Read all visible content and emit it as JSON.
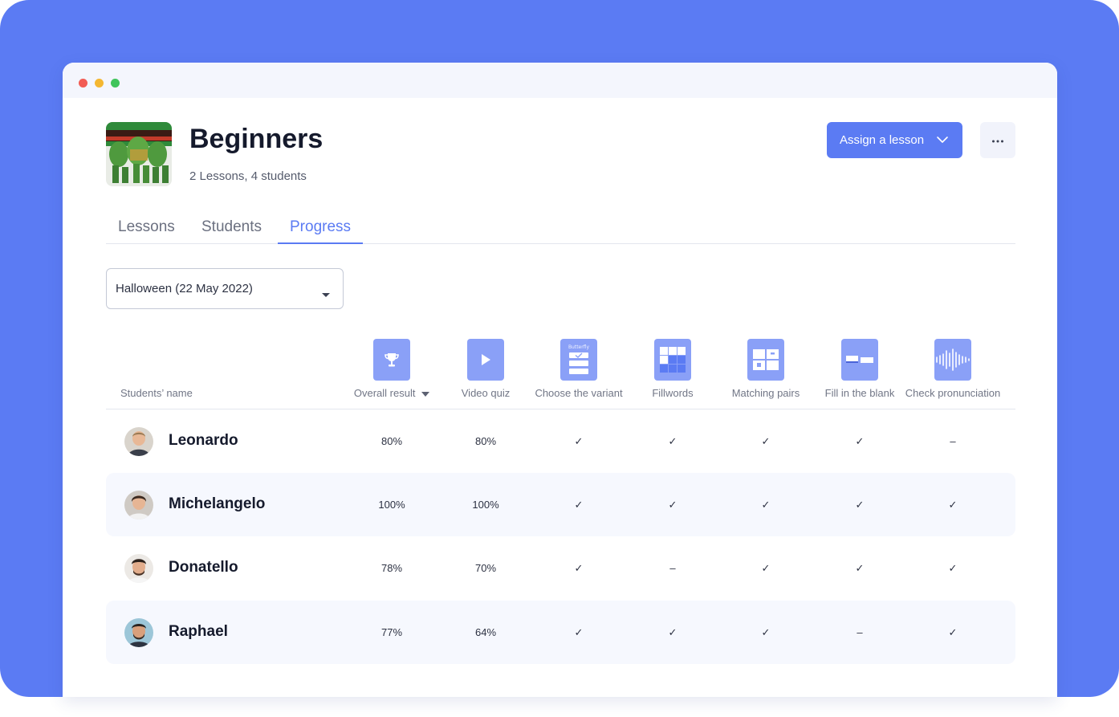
{
  "group": {
    "title": "Beginners",
    "subtitle": "2 Lessons, 4 students"
  },
  "actions": {
    "assign_label": "Assign a lesson",
    "assign_icon": "chevron-down-icon",
    "more_icon": "more-horizontal-icon"
  },
  "tabs": [
    {
      "label": "Lessons",
      "active": false
    },
    {
      "label": "Students",
      "active": false
    },
    {
      "label": "Progress",
      "active": true
    }
  ],
  "lesson_select": {
    "value": "Halloween (22 May 2022)",
    "icon": "caret-down-icon"
  },
  "table": {
    "name_header": "Students’ name",
    "columns": [
      {
        "label": "Overall result",
        "icon": "trophy-icon",
        "sortable": true
      },
      {
        "label": "Video quiz",
        "icon": "play-icon"
      },
      {
        "label": "Choose the variant",
        "icon": "choose-variant-icon",
        "icon_text": "Butterfly"
      },
      {
        "label": "Fillwords",
        "icon": "fillwords-grid-icon"
      },
      {
        "label": "Matching pairs",
        "icon": "matching-pairs-icon"
      },
      {
        "label": "Fill in the blank",
        "icon": "fill-blank-icon"
      },
      {
        "label": "Check pronunciation",
        "icon": "sound-wave-icon"
      }
    ],
    "rows": [
      {
        "name": "Leonardo",
        "cells": [
          "80%",
          "80%",
          "✓",
          "✓",
          "✓",
          "✓",
          "–"
        ]
      },
      {
        "name": "Michelangelo",
        "cells": [
          "100%",
          "100%",
          "✓",
          "✓",
          "✓",
          "✓",
          "✓"
        ]
      },
      {
        "name": "Donatello",
        "cells": [
          "78%",
          "70%",
          "✓",
          "–",
          "✓",
          "✓",
          "✓"
        ]
      },
      {
        "name": "Raphael",
        "cells": [
          "77%",
          "64%",
          "✓",
          "✓",
          "✓",
          "–",
          "✓"
        ]
      }
    ]
  },
  "colors": {
    "accent": "#5b7bf3",
    "icon_tile": "#8aa0f7",
    "row_alt": "#f6f8fe"
  }
}
